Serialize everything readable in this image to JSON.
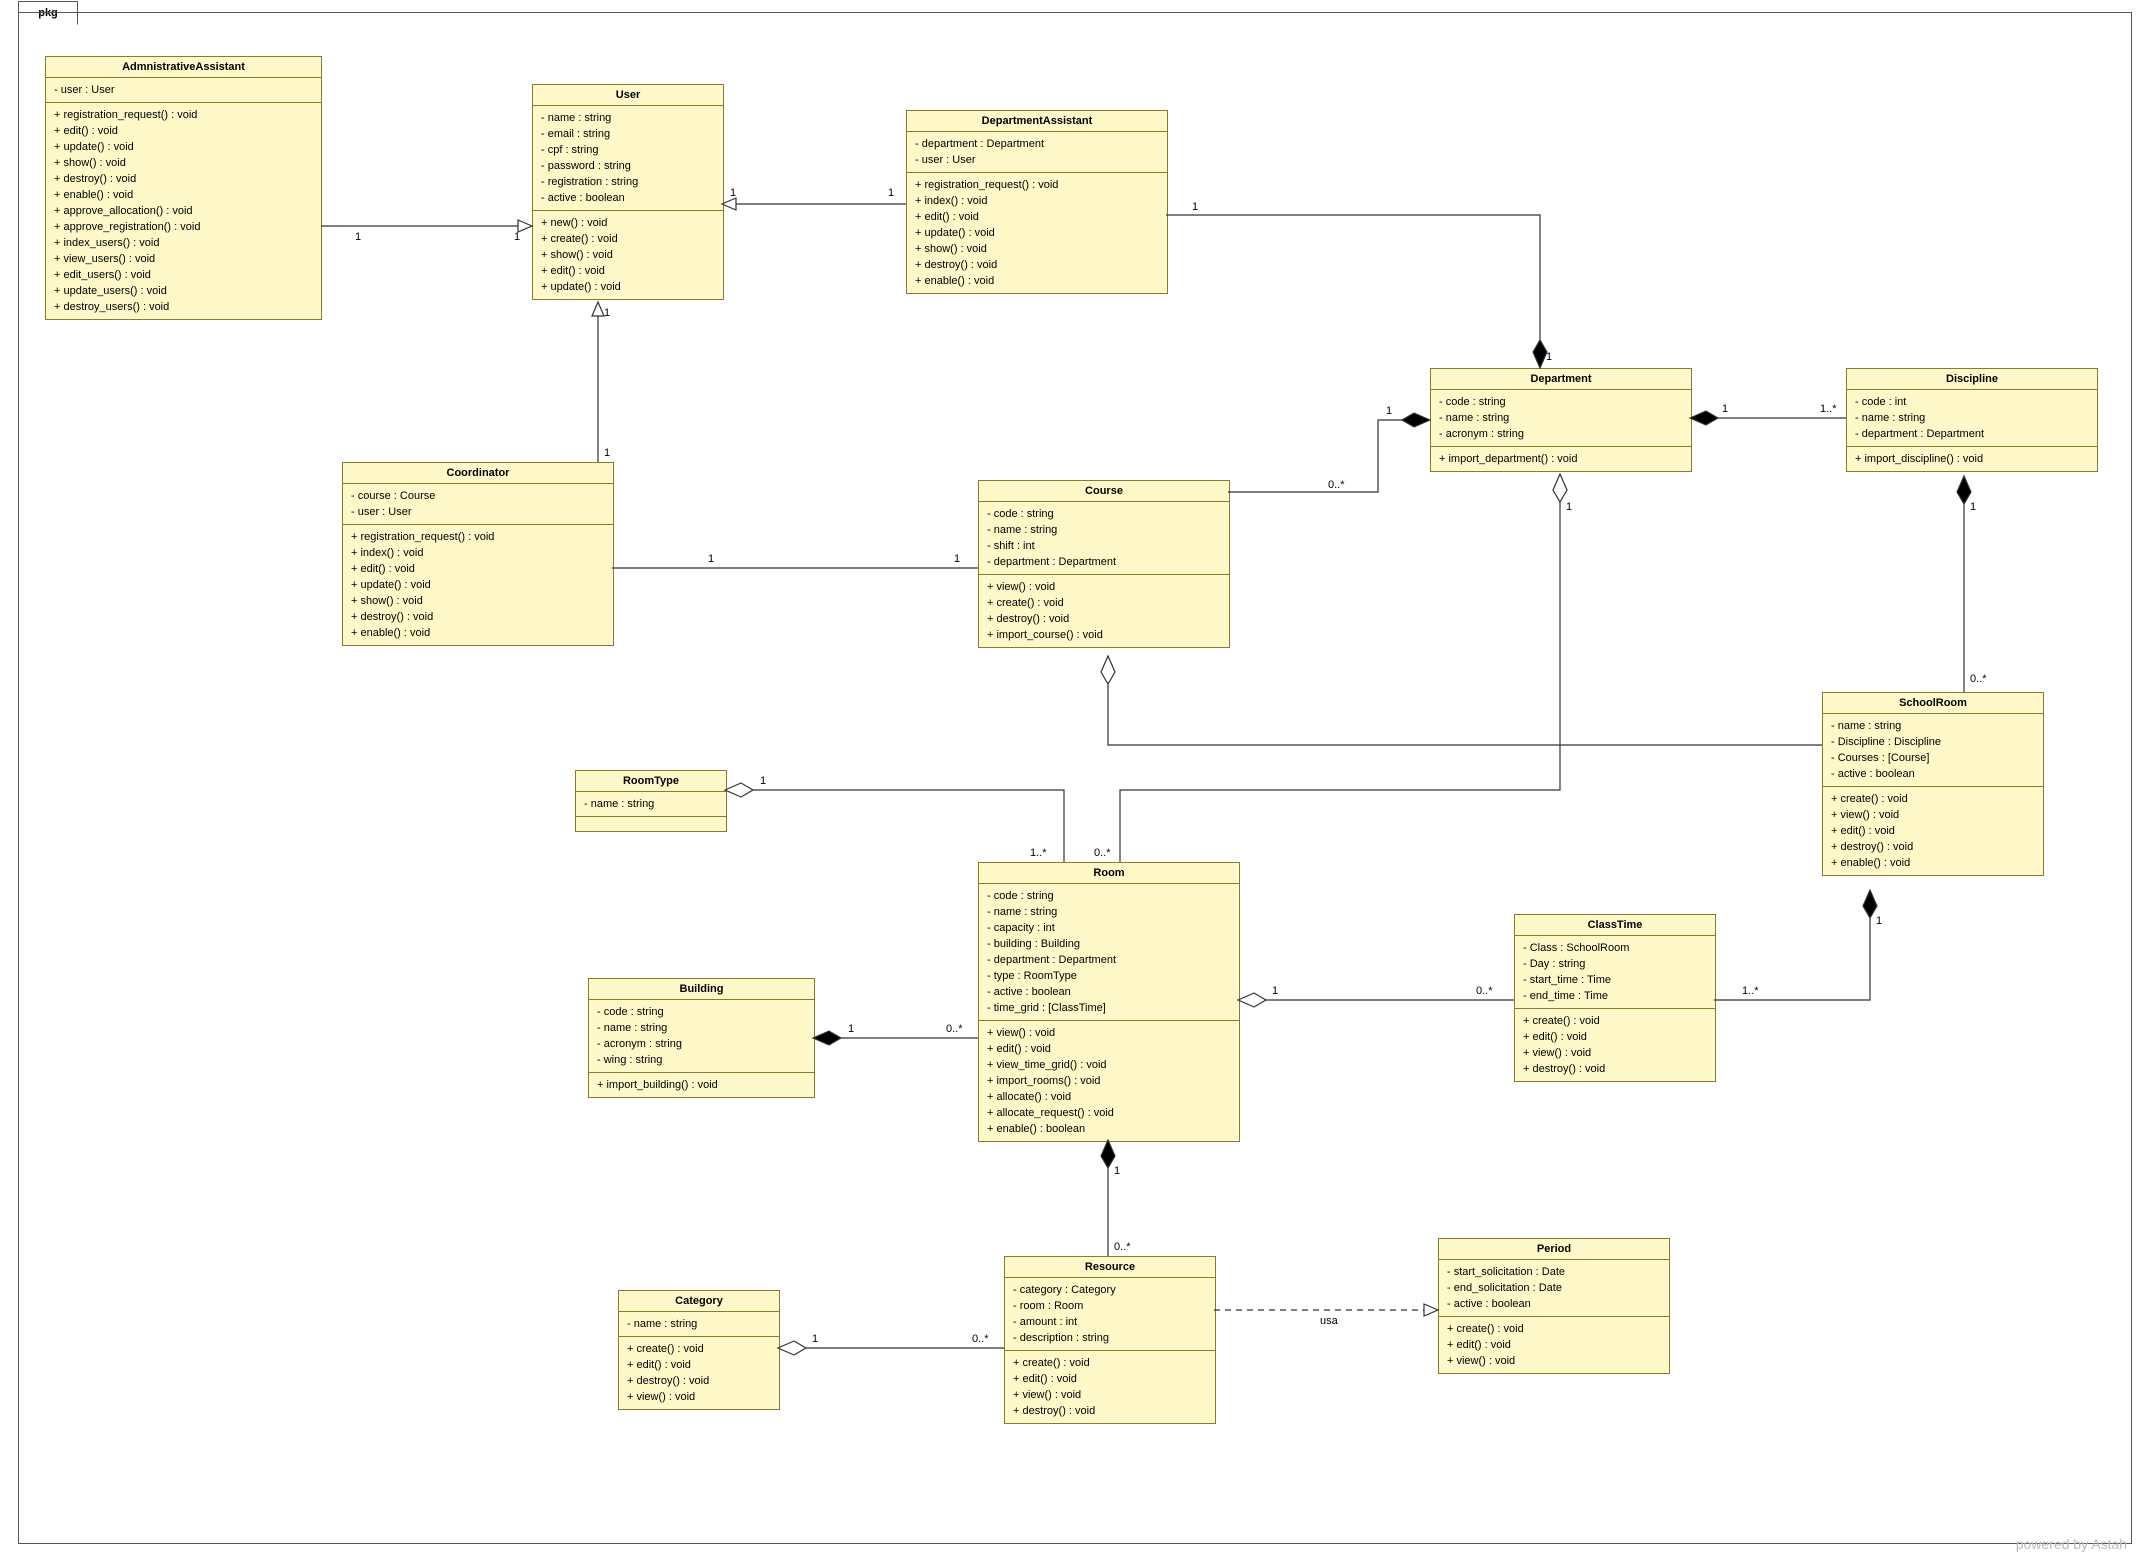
{
  "package_label": "pkg",
  "footer": "powered by Astah",
  "classes": {
    "admin": {
      "name": "AdmnistrativeAssistant",
      "attrs": [
        "- user : User"
      ],
      "ops": [
        "+ registration_request() : void",
        "+ edit() : void",
        "+ update() : void",
        "+ show() : void",
        "+ destroy() : void",
        "+ enable() : void",
        "+ approve_allocation() : void",
        "+ approve_registration() : void",
        "+ index_users() : void",
        "+ view_users() : void",
        "+ edit_users() : void",
        "+ update_users() : void",
        "+ destroy_users() : void"
      ]
    },
    "user": {
      "name": "User",
      "attrs": [
        "- name : string",
        "- email : string",
        "- cpf : string",
        "- password : string",
        "- registration : string",
        "- active : boolean"
      ],
      "ops": [
        "+ new() : void",
        "+ create() : void",
        "+ show() : void",
        "+ edit() : void",
        "+ update() : void"
      ]
    },
    "deptAssist": {
      "name": "DepartmentAssistant",
      "attrs": [
        "- department : Department",
        "- user : User"
      ],
      "ops": [
        "+ registration_request() : void",
        "+ index() : void",
        "+ edit() : void",
        "+ update() : void",
        "+ show() : void",
        "+ destroy() : void",
        "+ enable() : void"
      ]
    },
    "department": {
      "name": "Department",
      "attrs": [
        "- code : string",
        "- name : string",
        "- acronym : string"
      ],
      "ops": [
        "+ import_department() : void"
      ]
    },
    "discipline": {
      "name": "Discipline",
      "attrs": [
        "- code : int",
        "- name : string",
        "- department : Department"
      ],
      "ops": [
        "+ import_discipline() : void"
      ]
    },
    "coordinator": {
      "name": "Coordinator",
      "attrs": [
        "- course : Course",
        "- user : User"
      ],
      "ops": [
        "+ registration_request() : void",
        "+ index() : void",
        "+ edit() : void",
        "+ update() : void",
        "+ show() : void",
        "+ destroy() : void",
        "+ enable() : void"
      ]
    },
    "course": {
      "name": "Course",
      "attrs": [
        "- code : string",
        "- name : string",
        "- shift : int",
        "- department : Department"
      ],
      "ops": [
        "+ view() : void",
        "+ create() : void",
        "+ destroy() : void",
        "+ import_course() : void"
      ]
    },
    "schoolroom": {
      "name": "SchoolRoom",
      "attrs": [
        "- name : string",
        "- Discipline : Discipline",
        "- Courses : [Course]",
        "- active : boolean"
      ],
      "ops": [
        "+ create() : void",
        "+ view() : void",
        "+ edit() : void",
        "+ destroy() : void",
        "+ enable() : void"
      ]
    },
    "roomtype": {
      "name": "RoomType",
      "attrs": [
        "- name : string"
      ],
      "ops": []
    },
    "room": {
      "name": "Room",
      "attrs": [
        "- code : string",
        "- name : string",
        "- capacity : int",
        "- building : Building",
        "- department : Department",
        "- type : RoomType",
        "- active : boolean",
        "- time_grid : [ClassTime]"
      ],
      "ops": [
        "+ view() : void",
        "+ edit() : void",
        "+ view_time_grid() : void",
        "+ import_rooms() : void",
        "+ allocate() : void",
        "+ allocate_request() : void",
        "+ enable() : boolean"
      ]
    },
    "classtime": {
      "name": "ClassTime",
      "attrs": [
        "- Class : SchoolRoom",
        "- Day : string",
        "- start_time : Time",
        "- end_time : Time"
      ],
      "ops": [
        "+ create() : void",
        "+ edit() : void",
        "+ view() : void",
        "+ destroy() : void"
      ]
    },
    "building": {
      "name": "Building",
      "attrs": [
        "- code : string",
        "- name : string",
        "- acronym : string",
        "- wing : string"
      ],
      "ops": [
        "+ import_building() : void"
      ]
    },
    "period": {
      "name": "Period",
      "attrs": [
        "- start_solicitation : Date",
        "- end_solicitation : Date",
        "- active : boolean"
      ],
      "ops": [
        "+ create() : void",
        "+ edit() : void",
        "+ view() : void"
      ]
    },
    "resource": {
      "name": "Resource",
      "attrs": [
        "- category : Category",
        "- room : Room",
        "- amount : int",
        "- description : string"
      ],
      "ops": [
        "+ create() : void",
        "+ edit() : void",
        "+ view() : void",
        "+ destroy() : void"
      ]
    },
    "category": {
      "name": "Category",
      "attrs": [
        "- name : string"
      ],
      "ops": [
        "+ create() : void",
        "+ edit() : void",
        "+ destroy() : void",
        "+ view() : void"
      ]
    }
  },
  "chart_data": {
    "type": "uml-class-diagram",
    "package": "pkg",
    "classes": [
      "AdmnistrativeAssistant",
      "User",
      "DepartmentAssistant",
      "Department",
      "Discipline",
      "Coordinator",
      "Course",
      "SchoolRoom",
      "RoomType",
      "Room",
      "ClassTime",
      "Building",
      "Period",
      "Resource",
      "Category"
    ],
    "relationships": [
      {
        "from": "AdmnistrativeAssistant",
        "to": "User",
        "type": "association",
        "from_mult": "1",
        "to_mult": "1"
      },
      {
        "from": "DepartmentAssistant",
        "to": "User",
        "type": "association",
        "from_mult": "1",
        "to_mult": "1"
      },
      {
        "from": "Coordinator",
        "to": "User",
        "type": "association",
        "from_mult": "1",
        "to_mult": "1"
      },
      {
        "from": "Coordinator",
        "to": "Course",
        "type": "association",
        "from_mult": "1",
        "to_mult": "1"
      },
      {
        "from": "DepartmentAssistant",
        "to": "Department",
        "type": "composition",
        "owner": "Department",
        "from_mult": "1",
        "to_mult": "1"
      },
      {
        "from": "Course",
        "to": "Department",
        "type": "composition",
        "owner": "Department",
        "from_mult": "0..*",
        "to_mult": "1"
      },
      {
        "from": "Discipline",
        "to": "Department",
        "type": "composition",
        "owner": "Department",
        "from_mult": "1..*",
        "to_mult": "1"
      },
      {
        "from": "SchoolRoom",
        "to": "Discipline",
        "type": "composition",
        "owner": "Discipline",
        "from_mult": "0..*",
        "to_mult": "1"
      },
      {
        "from": "SchoolRoom",
        "to": "Course",
        "type": "aggregation",
        "owner": "Course"
      },
      {
        "from": "Room",
        "to": "RoomType",
        "type": "aggregation",
        "owner": "RoomType",
        "from_mult": "1..*",
        "to_mult": "1"
      },
      {
        "from": "Room",
        "to": "Department",
        "type": "aggregation",
        "owner": "Department",
        "from_mult": "0..*",
        "to_mult": "1"
      },
      {
        "from": "Room",
        "to": "Building",
        "type": "composition",
        "owner": "Building",
        "from_mult": "0..*",
        "to_mult": "1"
      },
      {
        "from": "Room",
        "to": "ClassTime",
        "type": "aggregation",
        "owner": "Room",
        "from_mult": "1",
        "to_mult": "0..*"
      },
      {
        "from": "ClassTime",
        "to": "SchoolRoom",
        "type": "composition",
        "owner": "SchoolRoom",
        "from_mult": "1..*",
        "to_mult": "1"
      },
      {
        "from": "Resource",
        "to": "Room",
        "type": "composition",
        "owner": "Room",
        "from_mult": "0..*",
        "to_mult": "1"
      },
      {
        "from": "Resource",
        "to": "Category",
        "type": "aggregation",
        "owner": "Category",
        "from_mult": "0..*",
        "to_mult": "1"
      },
      {
        "from": "Resource",
        "to": "Period",
        "type": "dependency",
        "label": "usa"
      }
    ]
  }
}
